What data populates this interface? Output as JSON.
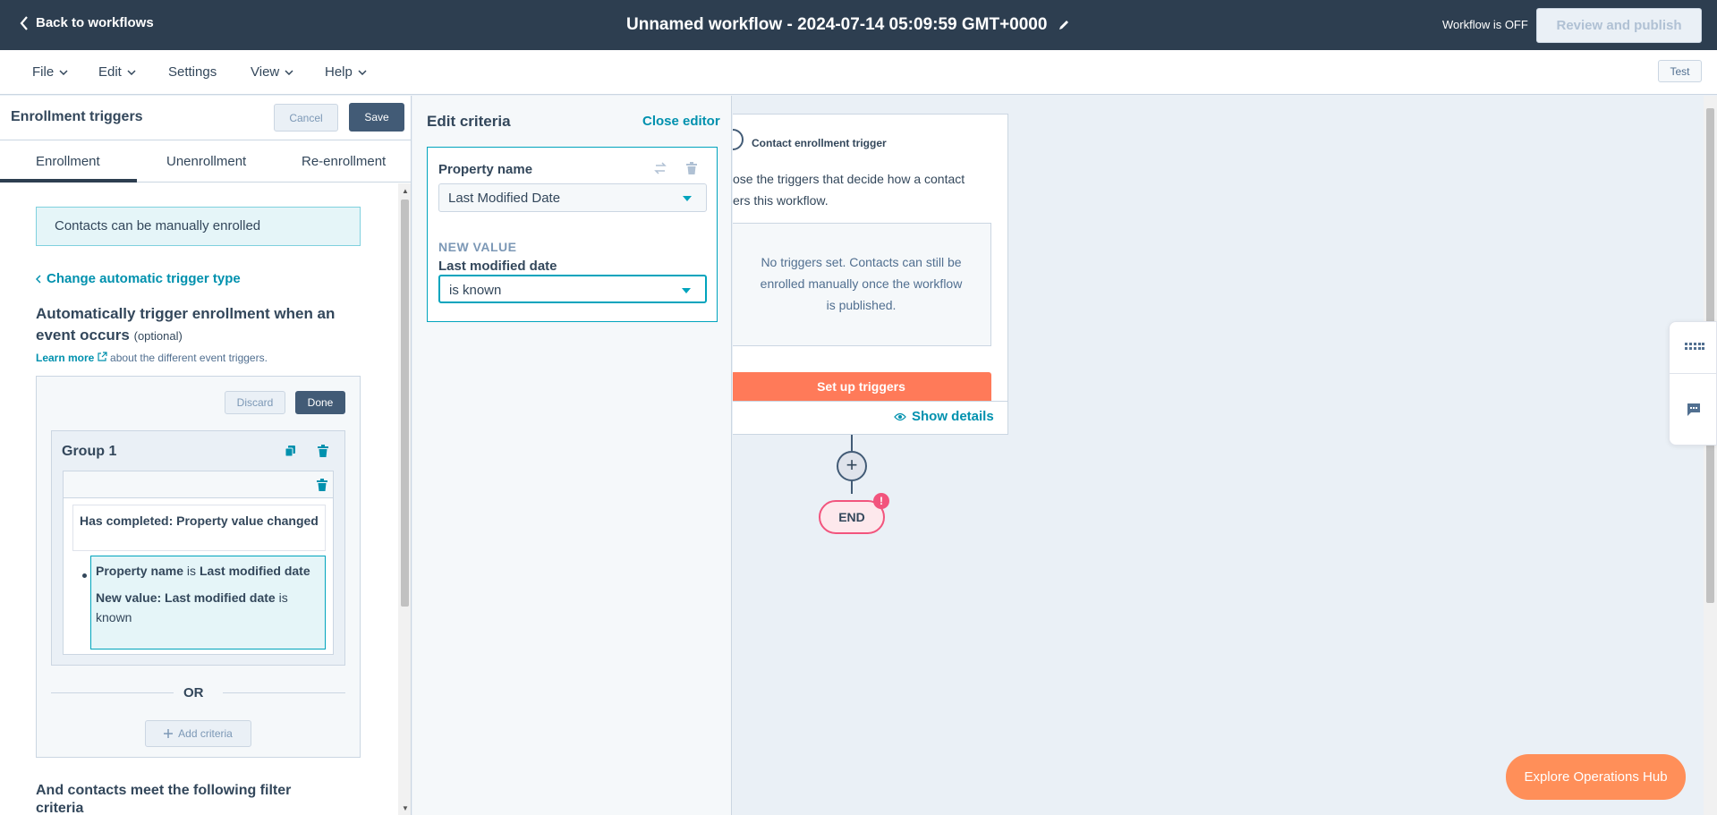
{
  "header": {
    "back_label": "Back to workflows",
    "title": "Unnamed workflow - 2024-07-14 05:09:59 GMT+0000",
    "status": "Workflow is OFF",
    "publish_label": "Review and publish"
  },
  "menu": {
    "file": "File",
    "edit": "Edit",
    "settings": "Settings",
    "view": "View",
    "help": "Help",
    "test": "Test"
  },
  "left_panel": {
    "title": "Enrollment triggers",
    "cancel": "Cancel",
    "save": "Save",
    "tabs": [
      "Enrollment",
      "Unenrollment",
      "Re-enrollment"
    ],
    "active_tab": "Enrollment",
    "manual_note": "Contacts can be manually enrolled",
    "change_trigger": "Change automatic trigger type",
    "auto_heading": "Automatically trigger enrollment when an event occurs",
    "optional": "(optional)",
    "learn_more": "Learn more",
    "learn_rest": "about the different event triggers.",
    "discard": "Discard",
    "done": "Done",
    "group_title": "Group 1",
    "completed": "Has completed: Property value changed",
    "criteria": {
      "part1_bold": "Property name",
      "part1_is": " is ",
      "part1_value": "Last modified date",
      "part2_bold": "New value: Last modified date",
      "part2_is": " is known"
    },
    "or": "OR",
    "add_criteria": "Add criteria",
    "and_heading": "And contacts meet the following filter criteria"
  },
  "editor": {
    "title": "Edit criteria",
    "close": "Close editor",
    "property_label": "Property name",
    "property_value": "Last Modified Date",
    "new_value_label": "NEW VALUE",
    "lm_label": "Last modified date",
    "operator_value": "is known"
  },
  "canvas": {
    "trigger_title": "Contact enrollment trigger",
    "trigger_desc_1": "ose the triggers that decide how a contact",
    "trigger_desc_2": "ers this workflow.",
    "no_triggers_1": "No triggers set. Contacts can still be",
    "no_triggers_2": "enrolled manually once the workflow",
    "no_triggers_3": "is published.",
    "setup": "Set up triggers",
    "show_details": "Show details",
    "plus": "+",
    "end": "END",
    "end_badge": "!"
  },
  "explore": "Explore Operations Hub",
  "colors": {
    "topbar": "#2d3e50",
    "accent_teal": "#00a4bd",
    "link": "#0091ae",
    "orange": "#ff7a59",
    "end_pink": "#f2547d"
  },
  "icons": [
    "chevron-left-icon",
    "pencil-icon",
    "chevron-down-icon",
    "swap-icon",
    "trash-icon",
    "copy-icon",
    "external-link-icon",
    "plus-icon",
    "eye-icon",
    "grid-icon",
    "chat-icon"
  ]
}
